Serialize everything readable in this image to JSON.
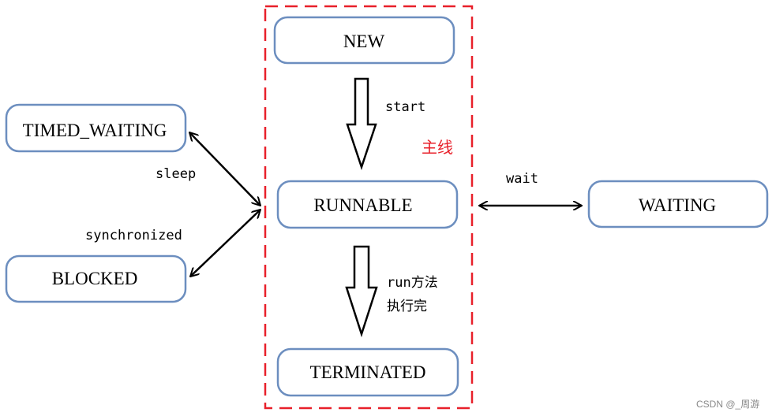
{
  "states": {
    "new": "NEW",
    "runnable": "RUNNABLE",
    "terminated": "TERMINATED",
    "timed_waiting": "TIMED_WAITING",
    "blocked": "BLOCKED",
    "waiting": "WAITING"
  },
  "transitions": {
    "start": "start",
    "sleep": "sleep",
    "synchronized": "synchronized",
    "wait": "wait",
    "run_done_line1": "run方法",
    "run_done_line2": "执行完"
  },
  "group_label": "主线",
  "watermark": "CSDN @_周游",
  "colors": {
    "box_border": "#6c8ebf",
    "main_line": "#e8202a",
    "arrow": "#000000"
  }
}
